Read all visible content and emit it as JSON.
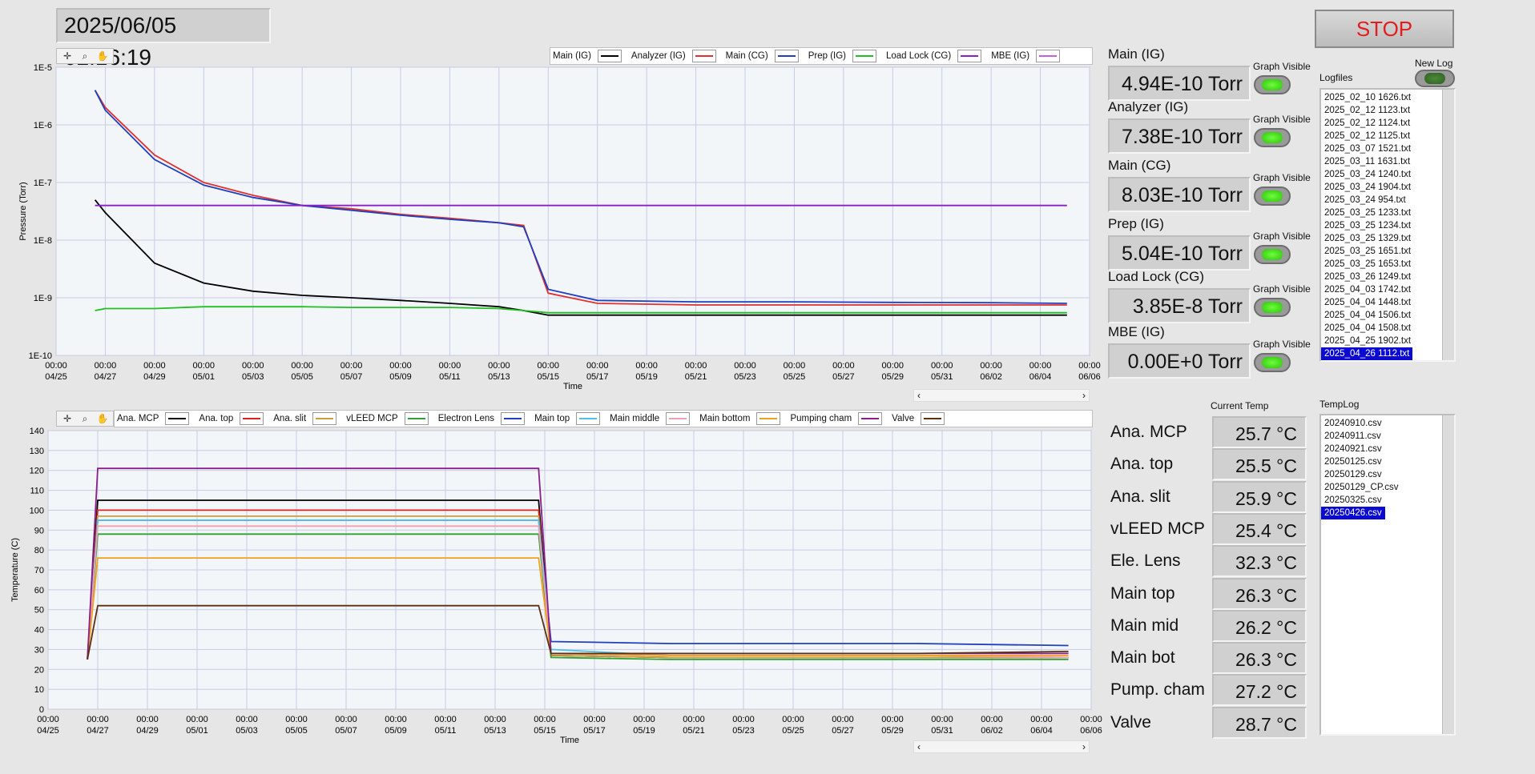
{
  "datetime": "2025/06/05  02:16:19",
  "stop_label": "STOP",
  "tool_icons": [
    "crosshair-icon",
    "zoom-icon",
    "pan-hand-icon"
  ],
  "pressure_chart": {
    "legend": [
      {
        "name": "Main (IG)",
        "color": "#000000"
      },
      {
        "name": "Analyzer (IG)",
        "color": "#e03030"
      },
      {
        "name": "Main (CG)",
        "color": "#1f3fc0"
      },
      {
        "name": "Prep (IG)",
        "color": "#20c020"
      },
      {
        "name": "Load Lock (CG)",
        "color": "#8a1fc8"
      },
      {
        "name": "MBE (IG)",
        "color": "#c060e0"
      }
    ],
    "ylabel": "Pressure (Torr)",
    "xlabel": "Time"
  },
  "temp_chart": {
    "legend": [
      {
        "name": "Ana. MCP",
        "color": "#000000"
      },
      {
        "name": "Ana. top",
        "color": "#e02020"
      },
      {
        "name": "Ana. slit",
        "color": "#c8a040"
      },
      {
        "name": "vLEED MCP",
        "color": "#30a030"
      },
      {
        "name": "Electron Lens",
        "color": "#1f3fc0"
      },
      {
        "name": "Main top",
        "color": "#50c0e8"
      },
      {
        "name": "Main middle",
        "color": "#f0a0b0"
      },
      {
        "name": "Main bottom",
        "color": "#f0a020"
      },
      {
        "name": "Pumping cham",
        "color": "#8a1f8a"
      },
      {
        "name": "Valve",
        "color": "#5a3010"
      }
    ],
    "ylabel": "Temperature (C)",
    "xlabel": "Time"
  },
  "chart_data": [
    {
      "type": "line",
      "ylabel": "Pressure (Torr)",
      "xlabel": "Time",
      "y_scale": "log",
      "ylim": [
        1e-10,
        1e-05
      ],
      "y_ticks": [
        "1E-10",
        "1E-9",
        "1E-8",
        "1E-7",
        "1E-6",
        "1E-5"
      ],
      "x_ticks": [
        [
          "00:00",
          "04/25"
        ],
        [
          "00:00",
          "04/27"
        ],
        [
          "00:00",
          "04/29"
        ],
        [
          "00:00",
          "05/01"
        ],
        [
          "00:00",
          "05/03"
        ],
        [
          "00:00",
          "05/05"
        ],
        [
          "00:00",
          "05/07"
        ],
        [
          "00:00",
          "05/09"
        ],
        [
          "00:00",
          "05/11"
        ],
        [
          "00:00",
          "05/13"
        ],
        [
          "00:00",
          "05/15"
        ],
        [
          "00:00",
          "05/17"
        ],
        [
          "00:00",
          "05/19"
        ],
        [
          "00:00",
          "05/21"
        ],
        [
          "00:00",
          "05/23"
        ],
        [
          "00:00",
          "05/25"
        ],
        [
          "00:00",
          "05/27"
        ],
        [
          "00:00",
          "05/29"
        ],
        [
          "00:00",
          "05/31"
        ],
        [
          "00:00",
          "06/02"
        ],
        [
          "00:00",
          "06/04"
        ],
        [
          "00:00",
          "06/06"
        ]
      ],
      "x": [
        "04/26 14:00",
        "04/27 00:00",
        "04/29 00:00",
        "05/01 00:00",
        "05/03 00:00",
        "05/05 00:00",
        "05/07 00:00",
        "05/09 00:00",
        "05/11 00:00",
        "05/13 00:00",
        "05/14 00:00",
        "05/15 00:00",
        "05/17 00:00",
        "05/21 00:00",
        "05/25 00:00",
        "05/29 00:00",
        "06/02 00:00",
        "06/05 02:00"
      ],
      "series": [
        {
          "name": "Main (IG)",
          "color": "#000000",
          "values": [
            5e-08,
            3e-08,
            4e-09,
            1.8e-09,
            1.3e-09,
            1.1e-09,
            1e-09,
            9e-10,
            8e-10,
            7e-10,
            6e-10,
            5e-10,
            5e-10,
            5e-10,
            5e-10,
            5e-10,
            5e-10,
            5e-10
          ]
        },
        {
          "name": "Analyzer (IG)",
          "color": "#e03030",
          "values": [
            4e-06,
            2e-06,
            3e-07,
            1e-07,
            6e-08,
            4e-08,
            3.5e-08,
            2.8e-08,
            2.4e-08,
            2e-08,
            1.8e-08,
            1.2e-09,
            8e-10,
            7.5e-10,
            7.5e-10,
            7.5e-10,
            7.5e-10,
            7.5e-10
          ]
        },
        {
          "name": "Main (CG)",
          "color": "#1f3fc0",
          "values": [
            4e-06,
            1.8e-06,
            2.5e-07,
            9e-08,
            5.5e-08,
            4e-08,
            3.3e-08,
            2.7e-08,
            2.3e-08,
            2e-08,
            1.7e-08,
            1.4e-09,
            9e-10,
            8.5e-10,
            8.5e-10,
            8.3e-10,
            8.2e-10,
            8e-10
          ]
        },
        {
          "name": "Prep (IG)",
          "color": "#20c020",
          "values": [
            6e-10,
            6.5e-10,
            6.5e-10,
            7e-10,
            7e-10,
            7e-10,
            6.8e-10,
            6.8e-10,
            6.8e-10,
            6.5e-10,
            6e-10,
            5.5e-10,
            5.5e-10,
            5.5e-10,
            5.5e-10,
            5.5e-10,
            5.5e-10,
            5.5e-10
          ]
        },
        {
          "name": "Load Lock (CG)",
          "color": "#8a1fc8",
          "values": [
            4e-08,
            4e-08,
            4e-08,
            4e-08,
            4e-08,
            4e-08,
            4e-08,
            4e-08,
            4e-08,
            4e-08,
            4e-08,
            4e-08,
            4e-08,
            4e-08,
            4e-08,
            4e-08,
            4e-08,
            4e-08
          ]
        }
      ]
    },
    {
      "type": "line",
      "ylabel": "Temperature (C)",
      "xlabel": "Time",
      "ylim": [
        0,
        140
      ],
      "y_ticks": [
        0,
        10,
        20,
        30,
        40,
        50,
        60,
        70,
        80,
        90,
        100,
        110,
        120,
        130,
        140
      ],
      "x_ticks": [
        [
          "00:00",
          "04/25"
        ],
        [
          "00:00",
          "04/27"
        ],
        [
          "00:00",
          "04/29"
        ],
        [
          "00:00",
          "05/01"
        ],
        [
          "00:00",
          "05/03"
        ],
        [
          "00:00",
          "05/05"
        ],
        [
          "00:00",
          "05/07"
        ],
        [
          "00:00",
          "05/09"
        ],
        [
          "00:00",
          "05/11"
        ],
        [
          "00:00",
          "05/13"
        ],
        [
          "00:00",
          "05/15"
        ],
        [
          "00:00",
          "05/17"
        ],
        [
          "00:00",
          "05/19"
        ],
        [
          "00:00",
          "05/21"
        ],
        [
          "00:00",
          "05/23"
        ],
        [
          "00:00",
          "05/25"
        ],
        [
          "00:00",
          "05/27"
        ],
        [
          "00:00",
          "05/29"
        ],
        [
          "00:00",
          "05/31"
        ],
        [
          "00:00",
          "06/02"
        ],
        [
          "00:00",
          "06/04"
        ],
        [
          "00:00",
          "06/06"
        ]
      ],
      "x": [
        "04/26 14:00",
        "04/27 00:00",
        "04/30 00:00",
        "05/05 00:00",
        "05/10 00:00",
        "05/14 18:00",
        "05/15 06:00",
        "05/20 00:00",
        "05/30 00:00",
        "06/05 02:00"
      ],
      "series": [
        {
          "name": "Ana. MCP",
          "color": "#000000",
          "values": [
            25,
            105,
            105,
            105,
            105,
            105,
            27,
            26,
            26,
            26
          ]
        },
        {
          "name": "Ana. top",
          "color": "#e02020",
          "values": [
            25,
            100,
            100,
            100,
            100,
            100,
            27,
            26,
            26,
            26
          ]
        },
        {
          "name": "Ana. slit",
          "color": "#c8a040",
          "values": [
            25,
            97,
            97,
            97,
            97,
            97,
            27,
            26,
            26,
            26
          ]
        },
        {
          "name": "vLEED MCP",
          "color": "#30a030",
          "values": [
            25,
            88,
            88,
            88,
            88,
            88,
            26,
            25,
            25,
            25
          ]
        },
        {
          "name": "Electron Lens",
          "color": "#1f3fc0",
          "values": [
            25,
            95,
            95,
            95,
            95,
            95,
            34,
            33,
            33,
            32
          ]
        },
        {
          "name": "Main top",
          "color": "#50c0e8",
          "values": [
            25,
            95,
            95,
            95,
            95,
            95,
            30,
            27,
            27,
            26
          ]
        },
        {
          "name": "Main middle",
          "color": "#f0a0b0",
          "values": [
            25,
            92,
            92,
            92,
            92,
            92,
            28,
            27,
            27,
            26
          ]
        },
        {
          "name": "Main bottom",
          "color": "#f0a020",
          "values": [
            25,
            76,
            76,
            76,
            76,
            76,
            28,
            27,
            27,
            27
          ]
        },
        {
          "name": "Pumping cham",
          "color": "#8a1f8a",
          "values": [
            25,
            121,
            121,
            121,
            121,
            121,
            28,
            28,
            28,
            28
          ]
        },
        {
          "name": "Valve",
          "color": "#5a3010",
          "values": [
            25,
            52,
            52,
            52,
            52,
            52,
            28,
            28,
            28,
            29
          ]
        }
      ]
    }
  ],
  "gauges": [
    {
      "label": "Main (IG)",
      "value": "4.94E-10 Torr"
    },
    {
      "label": "Analyzer (IG)",
      "value": "7.38E-10 Torr"
    },
    {
      "label": "Main (CG)",
      "value": "8.03E-10 Torr"
    },
    {
      "label": "Prep (IG)",
      "value": "5.04E-10 Torr"
    },
    {
      "label": "Load Lock (CG)",
      "value": "3.85E-8 Torr"
    },
    {
      "label": "MBE (IG)",
      "value": "0.00E+0 Torr"
    }
  ],
  "graph_visible_label": "Graph Visible",
  "logfiles": {
    "title": "Logfiles",
    "new_log_label": "New Log",
    "items": [
      "2025_02_10 1626.txt",
      "2025_02_12 1123.txt",
      "2025_02_12 1124.txt",
      "2025_02_12 1125.txt",
      "2025_03_07 1521.txt",
      "2025_03_11 1631.txt",
      "2025_03_24 1240.txt",
      "2025_03_24 1904.txt",
      "2025_03_24 954.txt",
      "2025_03_25 1233.txt",
      "2025_03_25 1234.txt",
      "2025_03_25 1329.txt",
      "2025_03_25 1651.txt",
      "2025_03_25 1653.txt",
      "2025_03_26 1249.txt",
      "2025_04_03 1742.txt",
      "2025_04_04 1448.txt",
      "2025_04_04 1506.txt",
      "2025_04_04 1508.txt",
      "2025_04_25 1902.txt",
      "2025_04_26 1112.txt"
    ],
    "selected": "2025_04_26 1112.txt"
  },
  "current_temp_title": "Current Temp",
  "temps": [
    {
      "label": "Ana. MCP",
      "value": "25.7 °C"
    },
    {
      "label": "Ana. top",
      "value": "25.5 °C"
    },
    {
      "label": "Ana. slit",
      "value": "25.9 °C"
    },
    {
      "label": "vLEED MCP",
      "value": "25.4 °C"
    },
    {
      "label": "Ele. Lens",
      "value": "32.3 °C"
    },
    {
      "label": "Main top",
      "value": "26.3 °C"
    },
    {
      "label": "Main mid",
      "value": "26.2 °C"
    },
    {
      "label": "Main bot",
      "value": "26.3 °C"
    },
    {
      "label": "Pump. cham",
      "value": "27.2 °C"
    },
    {
      "label": "Valve",
      "value": "28.7 °C"
    }
  ],
  "templog": {
    "title": "TempLog",
    "items": [
      "20240910.csv",
      "20240911.csv",
      "20240921.csv",
      "20250125.csv",
      "20250129.csv",
      "20250129_CP.csv",
      "20250325.csv",
      "20250426.csv"
    ],
    "selected": "20250426.csv"
  }
}
